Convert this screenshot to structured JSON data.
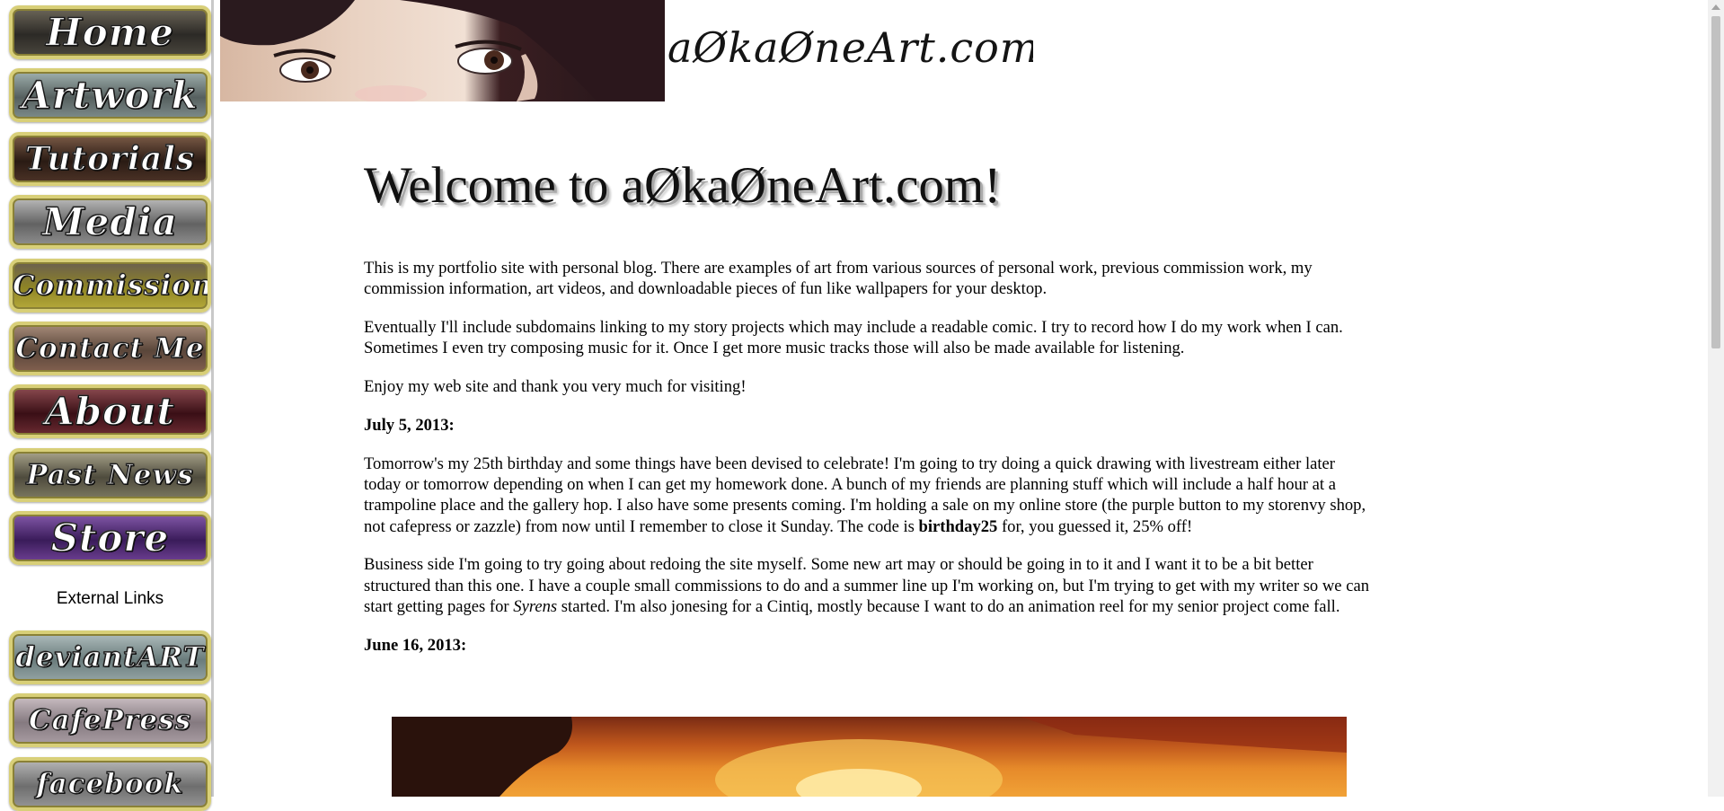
{
  "nav": {
    "items": [
      {
        "label": "Home",
        "bg": "#3d3a32"
      },
      {
        "label": "Artwork",
        "bg": "#5f6a6b"
      },
      {
        "label": "Tutorials",
        "bg": "#3f2a20"
      },
      {
        "label": "Media",
        "bg": "#6c6c6c"
      },
      {
        "label": "Commissions",
        "bg": "#7a7220"
      },
      {
        "label": "Contact Me",
        "bg": "#6d5a4b"
      },
      {
        "label": "About",
        "bg": "#5a1c24"
      },
      {
        "label": "Past News",
        "bg": "#6d6a55"
      },
      {
        "label": "Store",
        "bg": "#4c2a6a"
      }
    ],
    "external_heading": "External Links",
    "external_items": [
      {
        "label": "deviantART",
        "bg": "#7b8d8d"
      },
      {
        "label": "CafePress",
        "bg": "#8b7f86"
      },
      {
        "label": "facebook",
        "bg": "#7a7a7a"
      }
    ]
  },
  "banner": {
    "title": "aØkaØneArt.com"
  },
  "main": {
    "welcome": "Welcome to aØkaØneArt.com!",
    "intro1": "This is my portfolio site with personal blog. There are examples of art from various sources of personal work, previous commission work, my commission information, art videos, and downloadable pieces of fun like wallpapers for your desktop.",
    "intro2": "Eventually I'll include subdomains linking to my story projects which may include a readable comic. I try to record how I do my work when I can. Sometimes I even try composing music for it. Once I get more music tracks those will also be made available for listening.",
    "intro3": "Enjoy my web site and thank you very much for visiting!",
    "news": [
      {
        "date": "July 5, 2013:",
        "p1_before": "Tomorrow's my 25th birthday and some things have been devised to celebrate! I'm going to try doing a quick drawing with livestream either later today or tomorrow depending on when I can get my homework done. A bunch of my friends are planning stuff which will include a half hour at a trampoline place and the gallery hop. I also have some presents coming. I'm holding a sale on my online store (the purple button to my storenvy shop, not cafepress or zazzle) from now until I remember to close it Sunday. The code is ",
        "p1_bold": "birthday25",
        "p1_after": " for, you guessed it, 25% off!",
        "p2_before": "Business side I'm going to try going about redoing the site myself. Some new art may or should be going in to it and I want it to be a bit better structured than this one. I have a couple small commissions to do and a summer line up I'm working on, but I'm trying to get with my writer so we can start getting pages for ",
        "p2_italic": "Syrens",
        "p2_after": " started. I'm also jonesing for a Cintiq, mostly because I want to do an animation reel for my senior project come fall."
      },
      {
        "date": "June 16, 2013:"
      }
    ]
  }
}
